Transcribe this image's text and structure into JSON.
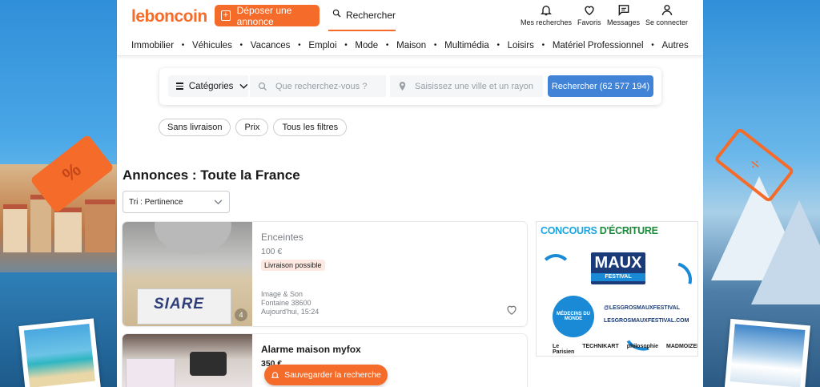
{
  "header": {
    "logo": "leboncoin",
    "post_label": "Déposer une annonce",
    "search_label": "Rechercher",
    "icons": [
      {
        "name": "bell-icon",
        "label": "Mes recherches"
      },
      {
        "name": "heart-icon",
        "label": "Favoris"
      },
      {
        "name": "message-icon",
        "label": "Messages"
      },
      {
        "name": "user-icon",
        "label": "Se connecter"
      }
    ]
  },
  "nav": [
    "Immobilier",
    "Véhicules",
    "Vacances",
    "Emploi",
    "Mode",
    "Maison",
    "Multimédia",
    "Loisirs",
    "Matériel Professionnel",
    "Autres"
  ],
  "search": {
    "category_label": "Catégories",
    "query_placeholder": "Que recherchez-vous ?",
    "location_placeholder": "Saisissez une ville et un rayon",
    "button_label": "Rechercher (62 577 194)"
  },
  "filters": [
    "Sans livraison",
    "Prix",
    "Tous les filtres"
  ],
  "page_title": "Annonces : Toute la France",
  "sort_label": "Tri : Pertinence",
  "listings": [
    {
      "title": "Enceintes",
      "price": "100 €",
      "badge": "Livraison possible",
      "category": "Image & Son",
      "location": "Fontaine 38600",
      "date": "Aujourd'hui, 15:24",
      "photo_count": "4",
      "photo_text": "SIARE"
    },
    {
      "title": "Alarme maison myfox",
      "price": "350 €"
    }
  ],
  "save_search_label": "Sauvegarder la recherche",
  "ad": {
    "headline_a": "CONCOURS",
    "headline_b": "D'ÉCRITURE",
    "brand": "MAUX",
    "brand_sub": "FESTIVAL",
    "partner": "MÉDECINS DU MONDE",
    "instagram": "@LESGROSMAUXFESTIVAL",
    "website": "LESGROSMAUXFESTIVAL.COM",
    "press": [
      "Le Parisien",
      "TECHNIKART",
      "philosophie",
      "MADMOIZELLE"
    ]
  },
  "colors": {
    "brand": "#f56b2a",
    "primary_button": "#4183d7"
  }
}
